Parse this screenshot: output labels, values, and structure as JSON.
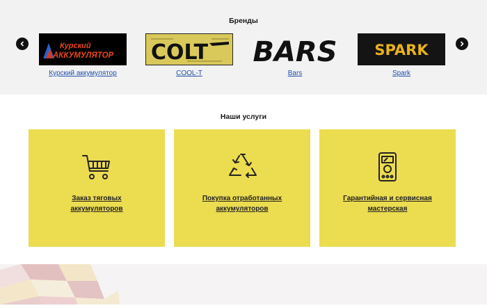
{
  "brands": {
    "title": "Бренды",
    "items": [
      {
        "label": "Курский аккумулятор",
        "logo_line1": "Курский",
        "logo_line2": "АККУМУЛЯТОР"
      },
      {
        "label": "COOL-T",
        "logo_text": "COLT"
      },
      {
        "label": "Bars",
        "logo_text": "BARS"
      },
      {
        "label": "Spark",
        "logo_text": "SPARK"
      }
    ]
  },
  "services": {
    "title": "Наши услуги",
    "items": [
      {
        "line1": "Заказ тяговых",
        "line2": "аккумуляторов"
      },
      {
        "line1": "Покупка отработанных",
        "line2": "аккумуляторов"
      },
      {
        "line1": "Гарантийная и сервисная",
        "line2": "мастерская"
      }
    ]
  },
  "colors": {
    "card": "#ecdc50",
    "link": "#1f4fa8",
    "brands_bg": "#f2f2f2"
  }
}
